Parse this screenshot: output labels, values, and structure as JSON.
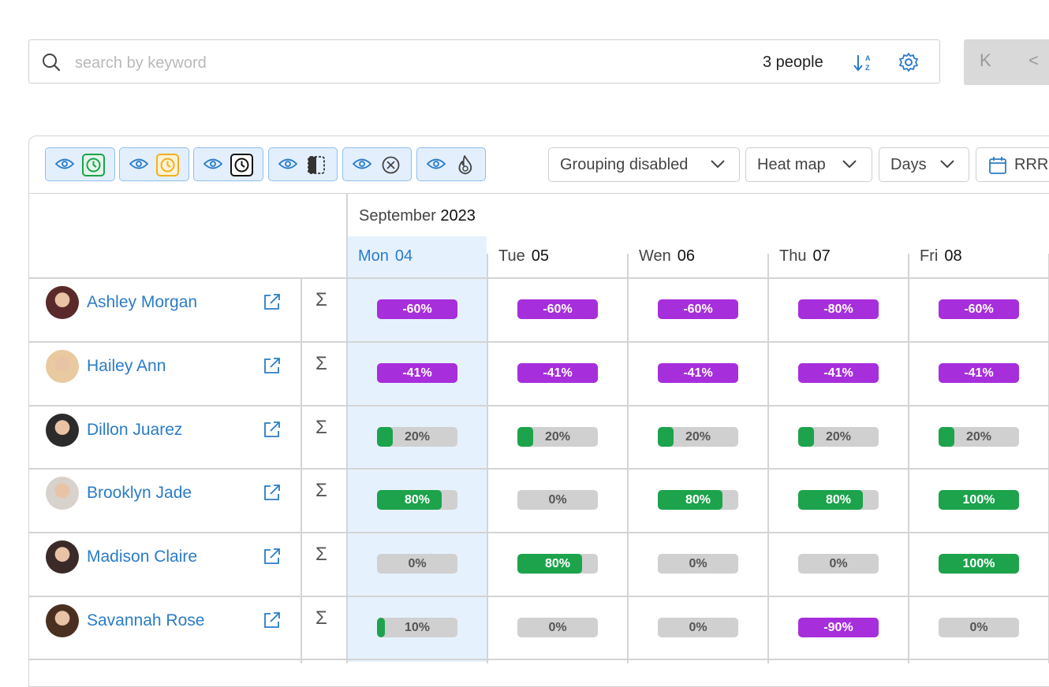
{
  "search": {
    "placeholder": "search by keyword",
    "count_label": "3 people"
  },
  "pager": {
    "first": "K",
    "prev": "<"
  },
  "toolbar": {
    "visibility_toggles": [
      {
        "status_icon": "clock-green-icon",
        "color": "#1ca34c"
      },
      {
        "status_icon": "clock-yellow-icon",
        "color": "#f2b01e"
      },
      {
        "status_icon": "clock-black-icon",
        "color": "#111111"
      },
      {
        "status_icon": "half-box-icon",
        "color": "#333333"
      },
      {
        "status_icon": "circle-x-icon",
        "color": "#444444"
      },
      {
        "status_icon": "flame-icon",
        "color": "#444444"
      }
    ],
    "grouping": "Grouping disabled",
    "view_mode": "Heat map",
    "period": "Days",
    "range": "RRR"
  },
  "calendar": {
    "month": "September",
    "year": "2023",
    "days": [
      {
        "name": "Mon",
        "num": "04",
        "active": true
      },
      {
        "name": "Tue",
        "num": "05"
      },
      {
        "name": "Wen",
        "num": "06"
      },
      {
        "name": "Thu",
        "num": "07"
      },
      {
        "name": "Fri",
        "num": "08"
      }
    ]
  },
  "people": [
    {
      "name": "Ashley Morgan",
      "cells": [
        {
          "label": "-60%",
          "value": -60
        },
        {
          "label": "-60%",
          "value": -60
        },
        {
          "label": "-60%",
          "value": -60
        },
        {
          "label": "-80%",
          "value": -80
        },
        {
          "label": "-60%",
          "value": -60
        }
      ]
    },
    {
      "name": "Hailey Ann",
      "cells": [
        {
          "label": "-41%",
          "value": -41
        },
        {
          "label": "-41%",
          "value": -41
        },
        {
          "label": "-41%",
          "value": -41
        },
        {
          "label": "-41%",
          "value": -41
        },
        {
          "label": "-41%",
          "value": -41
        }
      ]
    },
    {
      "name": "Dillon Juarez",
      "cells": [
        {
          "label": "20%",
          "value": 20
        },
        {
          "label": "20%",
          "value": 20
        },
        {
          "label": "20%",
          "value": 20
        },
        {
          "label": "20%",
          "value": 20
        },
        {
          "label": "20%",
          "value": 20
        }
      ]
    },
    {
      "name": "Brooklyn Jade",
      "cells": [
        {
          "label": "80%",
          "value": 80
        },
        {
          "label": "0%",
          "value": 0
        },
        {
          "label": "80%",
          "value": 80
        },
        {
          "label": "80%",
          "value": 80
        },
        {
          "label": "100%",
          "value": 100
        }
      ]
    },
    {
      "name": "Madison Claire",
      "cells": [
        {
          "label": "0%",
          "value": 0
        },
        {
          "label": "80%",
          "value": 80
        },
        {
          "label": "0%",
          "value": 0
        },
        {
          "label": "0%",
          "value": 0
        },
        {
          "label": "100%",
          "value": 100
        }
      ]
    },
    {
      "name": "Savannah Rose",
      "cells": [
        {
          "label": "10%",
          "value": 10
        },
        {
          "label": "0%",
          "value": 0
        },
        {
          "label": "0%",
          "value": 0
        },
        {
          "label": "-90%",
          "value": -90
        },
        {
          "label": "0%",
          "value": 0
        }
      ]
    }
  ],
  "colors": {
    "accent": "#2a7cc7",
    "positive": "#1ca34c",
    "negative": "#a72edb",
    "empty": "#d0d0d0",
    "highlight": "#e6f1fe"
  },
  "avatar_colors": [
    "#5a2a2a",
    "#e8c9a0",
    "#2b2b2b",
    "#d8d2cc",
    "#3a2a28",
    "#4a3020"
  ]
}
